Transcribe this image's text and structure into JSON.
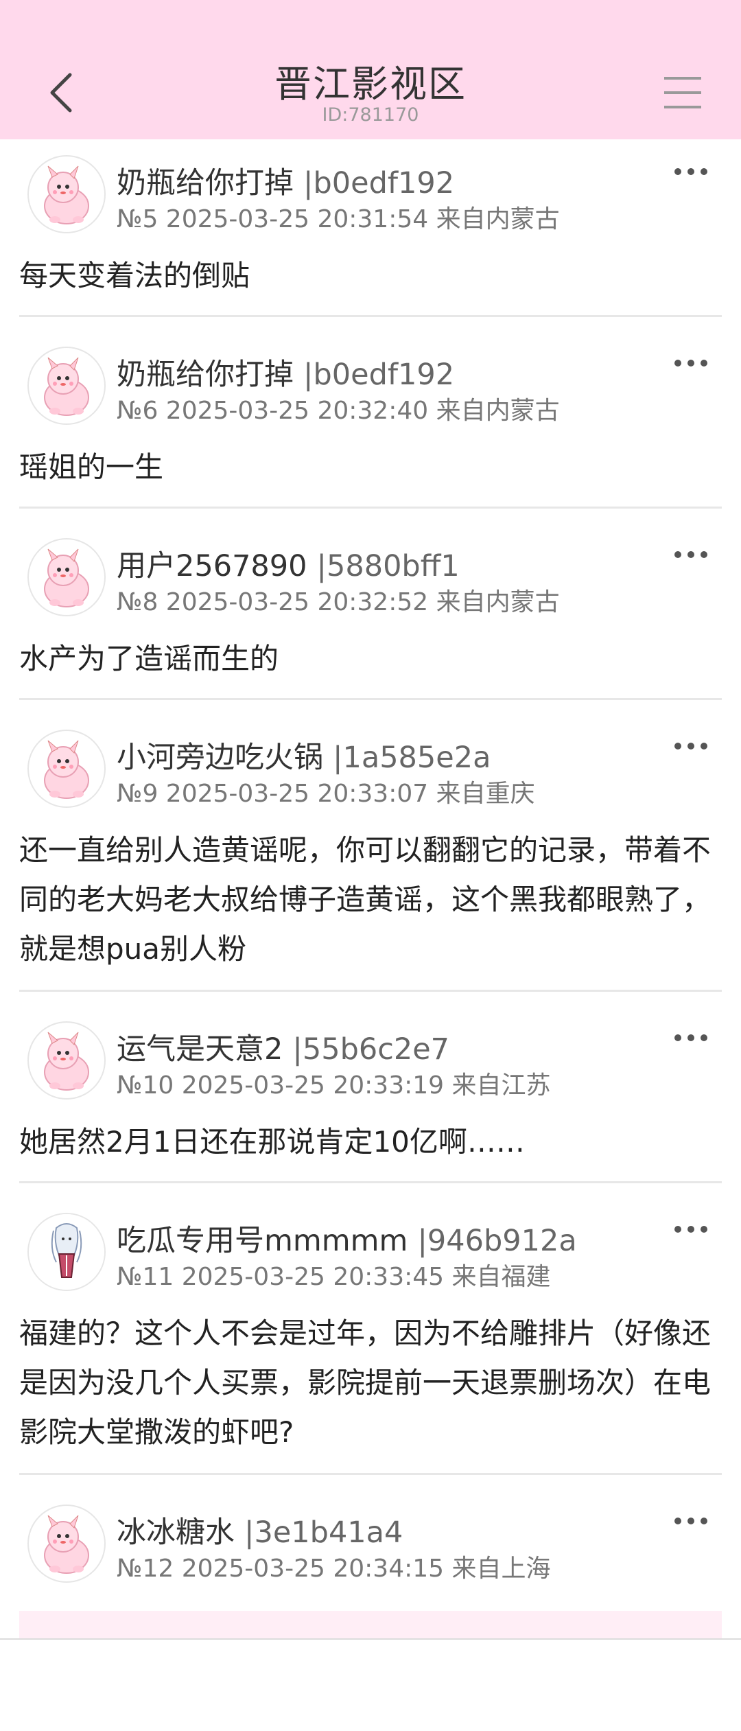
{
  "header": {
    "title": "晋江影视区",
    "id_text": "ID:781170",
    "back_icon": "chevron-left-icon",
    "menu_icon": "hamburger-menu-icon",
    "background": "#ffd9ec"
  },
  "posts": [
    {
      "username": "奶瓶给你打掉",
      "uid": "|b0edf192",
      "meta": "№5 2025-03-25 20:31:54 来自内蒙古",
      "body": "每天变着法的倒贴",
      "avatar": "pink-pokemon-avatar"
    },
    {
      "username": "奶瓶给你打掉",
      "uid": "|b0edf192",
      "meta": "№6 2025-03-25 20:32:40 来自内蒙古",
      "body": "瑶姐的一生",
      "avatar": "pink-pokemon-avatar"
    },
    {
      "username": "用户2567890",
      "uid": "|5880bff1",
      "meta": "№8 2025-03-25 20:32:52 来自内蒙古",
      "body": "水产为了造谣而生的",
      "avatar": "pink-pokemon-avatar"
    },
    {
      "username": "小河旁边吃火锅",
      "uid": "|1a585e2a",
      "meta": "№9 2025-03-25 20:33:07 来自重庆",
      "body": "还一直给别人造黄谣呢，你可以翻翻它的记录，带着不同的老大妈老大叔给博子造黄谣，这个黑我都眼熟了，就是想pua别人粉",
      "avatar": "pink-pokemon-avatar"
    },
    {
      "username": "运气是天意2",
      "uid": "|55b6c2e7",
      "meta": "№10 2025-03-25 20:33:19 来自江苏",
      "body": "她居然2月1日还在那说肯定10亿啊……",
      "avatar": "pink-pokemon-avatar"
    },
    {
      "username": "吃瓜专用号mmmmm",
      "uid": "|946b912a",
      "meta": "№11 2025-03-25 20:33:45 来自福建",
      "body": "福建的？这个人不会是过年，因为不给雕排片（好像还是因为没几个人买票，影院提前一天退票删场次）在电影院大堂撒泼的虾吧?",
      "avatar": "anime-character-avatar"
    },
    {
      "username": "冰冰糖水",
      "uid": "|3e1b41a4",
      "meta": "№12 2025-03-25 20:34:15 来自上海",
      "body": "",
      "avatar": "pink-pokemon-avatar"
    }
  ],
  "more_icon": "more-dots-icon"
}
